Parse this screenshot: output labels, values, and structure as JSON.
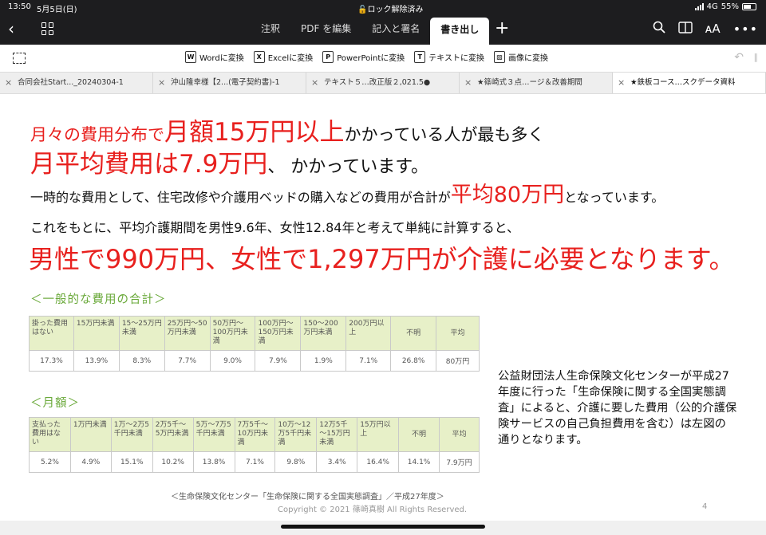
{
  "status": {
    "time": "13:50",
    "date": "5月5日(日)",
    "lock": "ロック解除済み",
    "network": "4G",
    "battery": "55%"
  },
  "toolbar": {
    "tabs": [
      "注釈",
      "PDF を編集",
      "記入と署名",
      "書き出し"
    ],
    "active_tab": "書き出し",
    "icons": [
      "back-icon",
      "grid-icon",
      "plus-icon",
      "search-icon",
      "book-icon",
      "text-size-icon",
      "more-icon"
    ]
  },
  "convert": {
    "items": [
      {
        "badge": "W",
        "label": "Wordに変換"
      },
      {
        "badge": "X",
        "label": "Excelに変換"
      },
      {
        "badge": "P",
        "label": "PowerPointに変換"
      },
      {
        "badge": "T",
        "label": "テキストに変換"
      },
      {
        "badge": "▨",
        "label": "画像に変換"
      }
    ]
  },
  "doc_tabs": [
    "合同会社Start..._20240304-1",
    "沖山隆幸様【2...(電子契約書)-1",
    "テキスト５…改正版２,021.5●",
    "★篠崎式３点…ージ＆改善期間",
    "★鉄板コース…スクデータ資料"
  ],
  "slide": {
    "line1": {
      "a": "月々の費用分布で",
      "b": "月額15万円以上",
      "c": "かかっている人が最も多く"
    },
    "line2": {
      "a": "月平均費用は7.9万円",
      "b": "、 かかっています。"
    },
    "line3": {
      "a": "一時的な費用として、住宅改修や介護用ベッドの購入などの費用が合計が",
      "b": "平均80万円",
      "c": "となっています。"
    },
    "line4": "これをもとに、平均介護期間を男性9.6年、女性12.84年と考えて単純に計算すると、",
    "line5": "男性で990万円、女性で1,297万円が介護に必要となります。",
    "table1": {
      "title": "＜一般的な費用の合計＞",
      "headers": [
        "掛った費用はない",
        "15万円未満",
        "15～25万円未満",
        "25万円～50万円未満",
        "50万円～100万円未満",
        "100万円～150万円未満",
        "150～200万円未満",
        "200万円以上",
        "不明",
        "平均"
      ],
      "values": [
        "17.3%",
        "13.9%",
        "8.3%",
        "7.7%",
        "9.0%",
        "7.9%",
        "1.9%",
        "7.1%",
        "26.8%",
        "80万円"
      ]
    },
    "table2": {
      "title": "＜月額＞",
      "headers": [
        "支払った費用はない",
        "1万円未満",
        "1万～2万5千円未満",
        "2万5千～5万円未満",
        "5万～7万5千円未満",
        "7万5千～10万円未満",
        "10万～12万5千円未満",
        "12万5千～15万円未満",
        "15万円以上",
        "不明",
        "平均"
      ],
      "values": [
        "5.2%",
        "4.9%",
        "15.1%",
        "10.2%",
        "13.8%",
        "7.1%",
        "9.8%",
        "3.4%",
        "16.4%",
        "14.1%",
        "7.9万円"
      ]
    },
    "note": "公益財団法人生命保険文化センターが平成27年度に行った「生命保険に関する全国実態調査」によると、介護に要した費用（公的介護保険サービスの自己負担費用を含む）は左図の通りとなります。",
    "source": "＜生命保険文化センター「生命保険に関する全国実態調査」／平成27年度＞",
    "copyright": "Copyright © 2021 篠崎真樹 All Rights Reserved.",
    "page_number": "4"
  },
  "colors": {
    "accent_red": "#e8201e",
    "section_green": "#6aa93a",
    "header_fill": "#e7f0c8",
    "toolbar_dark": "#1d1d1f"
  }
}
